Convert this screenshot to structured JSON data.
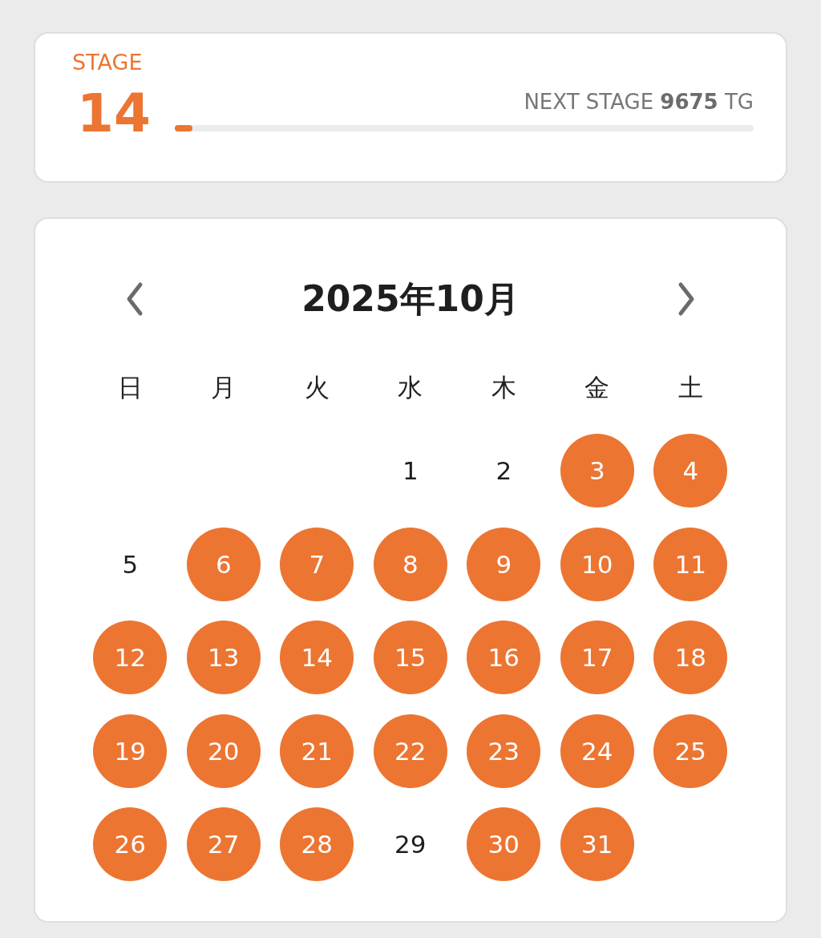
{
  "stage": {
    "label": "STAGE",
    "number": "14",
    "next_stage": "NEXT STAGE **9675** TG",
    "level": 0.03
  },
  "calendar": {
    "title": "2025年10月",
    "weekdays": [
      "日",
      "月",
      "火",
      "水",
      "木",
      "金",
      "土"
    ],
    "weeks": [
      [
        {
          "kind": "blank"
        },
        {
          "kind": "blank"
        },
        {
          "kind": "blank"
        },
        {
          "kind": "day",
          "day": "1",
          "marked": false
        },
        {
          "kind": "day",
          "day": "2",
          "marked": false
        },
        {
          "kind": "day",
          "day": "3",
          "marked": true
        },
        {
          "kind": "day",
          "day": "4",
          "marked": true
        }
      ],
      [
        {
          "kind": "day",
          "day": "5",
          "marked": false
        },
        {
          "kind": "day",
          "day": "6",
          "marked": true
        },
        {
          "kind": "day",
          "day": "7",
          "marked": true
        },
        {
          "kind": "day",
          "day": "8",
          "marked": true
        },
        {
          "kind": "day",
          "day": "9",
          "marked": true
        },
        {
          "kind": "day",
          "day": "10",
          "marked": true
        },
        {
          "kind": "day",
          "day": "11",
          "marked": true
        }
      ],
      [
        {
          "kind": "day",
          "day": "12",
          "marked": true
        },
        {
          "kind": "day",
          "day": "13",
          "marked": true
        },
        {
          "kind": "day",
          "day": "14",
          "marked": true
        },
        {
          "kind": "day",
          "day": "15",
          "marked": true
        },
        {
          "kind": "day",
          "day": "16",
          "marked": true
        },
        {
          "kind": "day",
          "day": "17",
          "marked": true
        },
        {
          "kind": "day",
          "day": "18",
          "marked": true
        }
      ],
      [
        {
          "kind": "day",
          "day": "19",
          "marked": true
        },
        {
          "kind": "day",
          "day": "20",
          "marked": true
        },
        {
          "kind": "day",
          "day": "21",
          "marked": true
        },
        {
          "kind": "day",
          "day": "22",
          "marked": true
        },
        {
          "kind": "day",
          "day": "23",
          "marked": true
        },
        {
          "kind": "day",
          "day": "24",
          "marked": true
        },
        {
          "kind": "day",
          "day": "25",
          "marked": true
        }
      ],
      [
        {
          "kind": "day",
          "day": "26",
          "marked": true
        },
        {
          "kind": "day",
          "day": "27",
          "marked": true
        },
        {
          "kind": "day",
          "day": "28",
          "marked": true
        },
        {
          "kind": "day",
          "day": "29",
          "marked": false
        },
        {
          "kind": "day",
          "day": "30",
          "marked": true
        },
        {
          "kind": "day",
          "day": "31",
          "marked": true
        },
        {
          "kind": "blank"
        }
      ]
    ]
  }
}
